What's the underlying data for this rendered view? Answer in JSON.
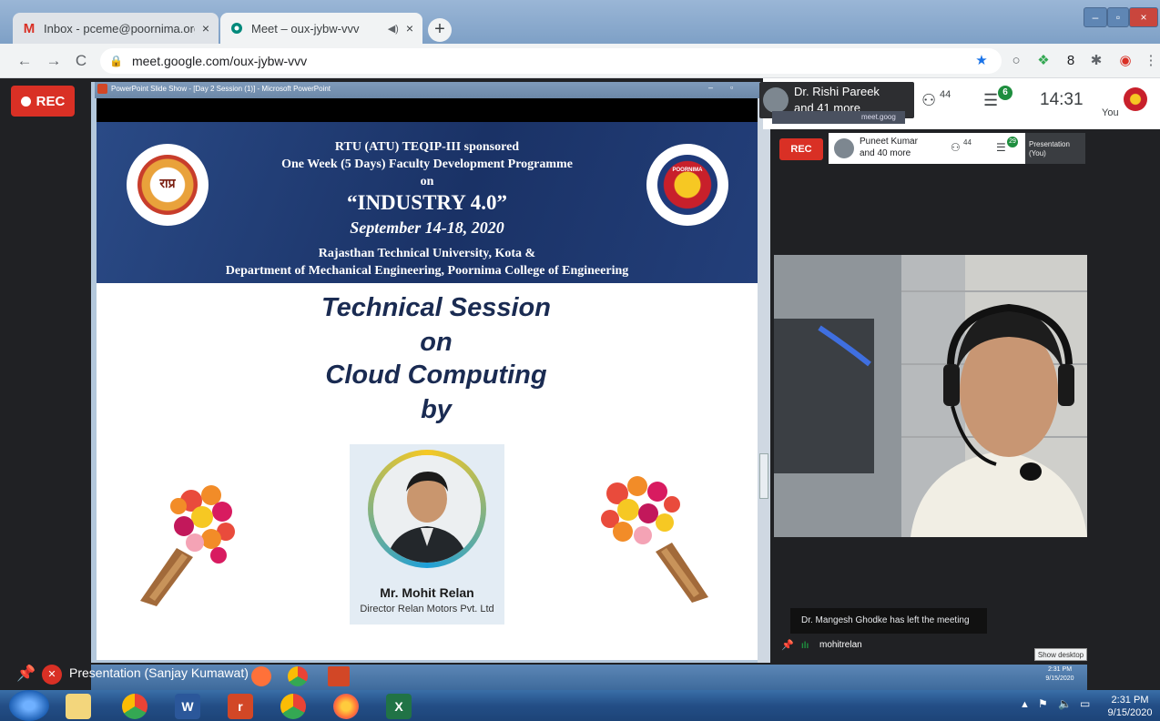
{
  "browser": {
    "tabs": [
      {
        "title": "Inbox - pceme@poornima.org - Poornima College of Engineering Mail",
        "icon": "gmail-icon",
        "close": "×"
      },
      {
        "title": "Meet – oux-jybw-vvv",
        "icon": "meet-icon",
        "close": "×",
        "mute": "◀)"
      }
    ],
    "new_tab": "+",
    "window_controls": [
      "–",
      "▫",
      "×"
    ],
    "nav": {
      "back": "←",
      "forward": "→",
      "reload": "C"
    },
    "url": "meet.google.com/oux-jybw-vvv",
    "extension_icons": [
      "★",
      "○",
      "❖",
      "8",
      "✱",
      "◉",
      "⋮"
    ]
  },
  "meet": {
    "rec_label": "REC",
    "host_name": "Dr. Rishi Pareek",
    "host_more": "and 41 more",
    "participants_count": "44",
    "chat_count": "6",
    "time": "14:31",
    "you_label": "You",
    "presenter_label": "Presentation (Sanjay Kumawat)",
    "accent_red": "#d93025"
  },
  "powerpoint": {
    "title": "PowerPoint Slide Show - [Day 2 Session (1)] - Microsoft PowerPoint",
    "buttons": [
      "–",
      "▫"
    ]
  },
  "slide": {
    "header_line1": "RTU (ATU) TEQIP-III sponsored",
    "header_line2": "One Week (5 Days) Faculty Development Programme",
    "header_line3": "on",
    "header_title": "“INDUSTRY 4.0”",
    "header_date": "September 14-18, 2020",
    "header_org1": "Rajasthan Technical University, Kota &",
    "header_org2": "Department of Mechanical Engineering, Poornima College of Engineering",
    "session_line1": "Technical Session",
    "session_line2": "on",
    "session_line3": "Cloud Computing",
    "session_line4": "by",
    "speaker_name": "Mr. Mohit Relan",
    "speaker_title": "Director Relan Motors Pvt. Ltd",
    "logo_left_text": "राप्र",
    "logo_right_text": "POORNIMA"
  },
  "right_panel": {
    "inner_url": "meet.goog",
    "inner_rec_label": "REC",
    "inner_host_name": "Puneet Kumar",
    "inner_host_more": "and 40 more",
    "inner_participants": "44",
    "inner_chat": "29",
    "inner_presentation": "Presentation (You)",
    "toast": "Dr. Mangesh Ghodke has left the meeting",
    "speaker_label": "mohitrelan",
    "show_desktop": "Show desktop"
  },
  "inner_taskbar": {
    "time": "2:31 PM",
    "date": "9/15/2020"
  },
  "taskbar": {
    "time": "2:31 PM",
    "date": "9/15/2020",
    "apps": [
      "start-orb",
      "file-explorer",
      "chrome",
      "word",
      "app-red",
      "chrome-2",
      "firefox",
      "excel"
    ]
  }
}
